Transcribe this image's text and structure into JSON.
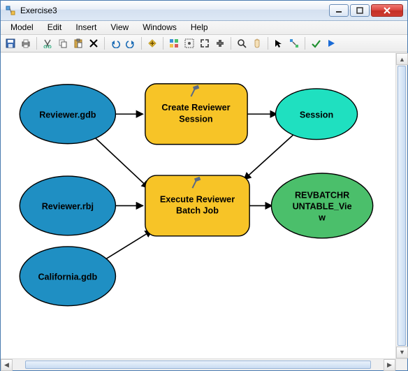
{
  "window": {
    "title": "Exercise3"
  },
  "menu": {
    "items": [
      "Model",
      "Edit",
      "Insert",
      "View",
      "Windows",
      "Help"
    ]
  },
  "toolbar": {
    "items": [
      {
        "name": "save-icon"
      },
      {
        "name": "print-icon"
      },
      {
        "sep": true
      },
      {
        "name": "cut-icon"
      },
      {
        "name": "copy-icon"
      },
      {
        "name": "paste-icon"
      },
      {
        "name": "delete-icon"
      },
      {
        "sep": true
      },
      {
        "name": "undo-icon"
      },
      {
        "name": "redo-icon"
      },
      {
        "sep": true
      },
      {
        "name": "add-data-icon"
      },
      {
        "sep": true
      },
      {
        "name": "auto-layout-icon"
      },
      {
        "name": "full-extent-icon"
      },
      {
        "name": "zoom-in-icon"
      },
      {
        "name": "zoom-out-icon"
      },
      {
        "sep": true
      },
      {
        "name": "fixed-zoom-icon"
      },
      {
        "name": "pan-icon"
      },
      {
        "sep": true
      },
      {
        "name": "select-icon"
      },
      {
        "name": "connect-icon"
      },
      {
        "sep": true
      },
      {
        "name": "validate-icon"
      },
      {
        "name": "run-icon"
      }
    ]
  },
  "diagram": {
    "nodes": {
      "reviewer_gdb": {
        "label": "Reviewer.gdb",
        "type": "data"
      },
      "reviewer_rbj": {
        "label": "Reviewer.rbj",
        "type": "data"
      },
      "california_gdb": {
        "label": "California.gdb",
        "type": "data"
      },
      "create_session": {
        "label": "Create Reviewer Session",
        "type": "tool"
      },
      "execute_batch": {
        "label": "Execute Reviewer Batch Job",
        "type": "tool"
      },
      "session": {
        "label": "Session",
        "type": "output"
      },
      "revbatch_view": {
        "label": "REVBATCHRUNTABLE_View",
        "type": "output-green"
      }
    },
    "edges": [
      {
        "from": "reviewer_gdb",
        "to": "create_session"
      },
      {
        "from": "reviewer_gdb",
        "to": "execute_batch"
      },
      {
        "from": "create_session",
        "to": "session"
      },
      {
        "from": "session",
        "to": "execute_batch"
      },
      {
        "from": "reviewer_rbj",
        "to": "execute_batch"
      },
      {
        "from": "california_gdb",
        "to": "execute_batch"
      },
      {
        "from": "execute_batch",
        "to": "revbatch_view"
      }
    ]
  }
}
